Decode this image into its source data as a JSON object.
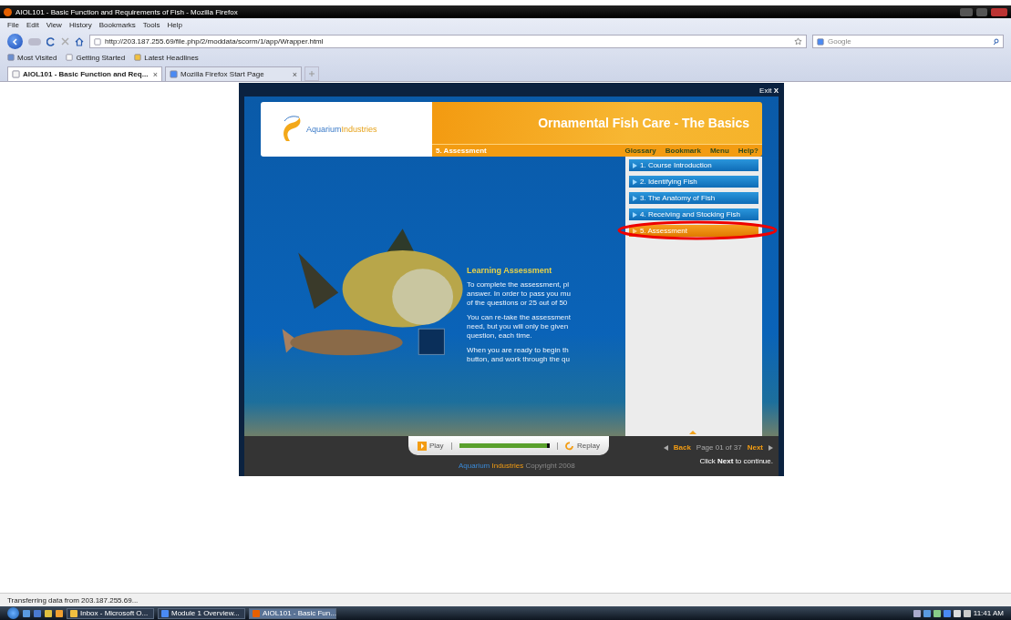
{
  "window": {
    "title": "AIOL101 - Basic Function and Requirements of Fish - Mozilla Firefox"
  },
  "menu": [
    "File",
    "Edit",
    "View",
    "History",
    "Bookmarks",
    "Tools",
    "Help"
  ],
  "address": {
    "value": "http://203.187.255.69/file.php/2/moddata/scorm/1/app/Wrapper.html"
  },
  "search": {
    "placeholder": "Google"
  },
  "bookmarks": [
    "Most Visited",
    "Getting Started",
    "Latest Headlines"
  ],
  "tabs": [
    {
      "label": "AIOL101 - Basic Function and Req...",
      "selected": true,
      "close": "×"
    },
    {
      "label": "Mozilla Firefox Start Page",
      "selected": false,
      "close": "×"
    }
  ],
  "course": {
    "exit": "Exit",
    "exit_mark": "X",
    "logo_part1": "Aquarium",
    "logo_part2": "Industries",
    "title": "Ornamental Fish Care - The Basics",
    "section": "5. Assessment",
    "nav": [
      "Glossary",
      "Bookmark",
      "Menu",
      "Help?"
    ],
    "modules": [
      {
        "label": "1.  Course Introduction",
        "selected": false
      },
      {
        "label": "2.  Identifying Fish",
        "selected": false
      },
      {
        "label": "3.  The Anatomy of Fish",
        "selected": false
      },
      {
        "label": "4.  Receiving and Stocking Fish",
        "selected": false
      },
      {
        "label": "5.  Assessment",
        "selected": true
      }
    ],
    "heading": "Learning Assessment",
    "paragraphs": [
      [
        "To complete the assessment, pl",
        "answer. In order to pass you mu",
        "of the questions or 25 out of 50"
      ],
      [
        "You can re-take the assessment",
        "need, but you will only be given",
        "question, each time."
      ],
      [
        "When you are ready to begin th",
        "button, and work through the qu"
      ]
    ],
    "player": {
      "play": "Play",
      "replay": "Replay",
      "level": 1.0
    },
    "back": "Back",
    "page": "Page 01 of 37",
    "next": "Next",
    "footer_part1": "Aquarium",
    "footer_part2": "Industries",
    "copyright": "Copyright 2008",
    "hint_before": "Click",
    "hint_bold": "Next",
    "hint_after": "to continue."
  },
  "status_bar": "Transferring data from 203.187.255.69...",
  "taskbar": {
    "tasks": [
      {
        "label": "Inbox - Microsoft O...",
        "selected": false
      },
      {
        "label": "Module 1 Overview...",
        "selected": false
      },
      {
        "label": "AIOL101 - Basic Fun...",
        "selected": true
      }
    ],
    "clock": "11:41 AM"
  }
}
